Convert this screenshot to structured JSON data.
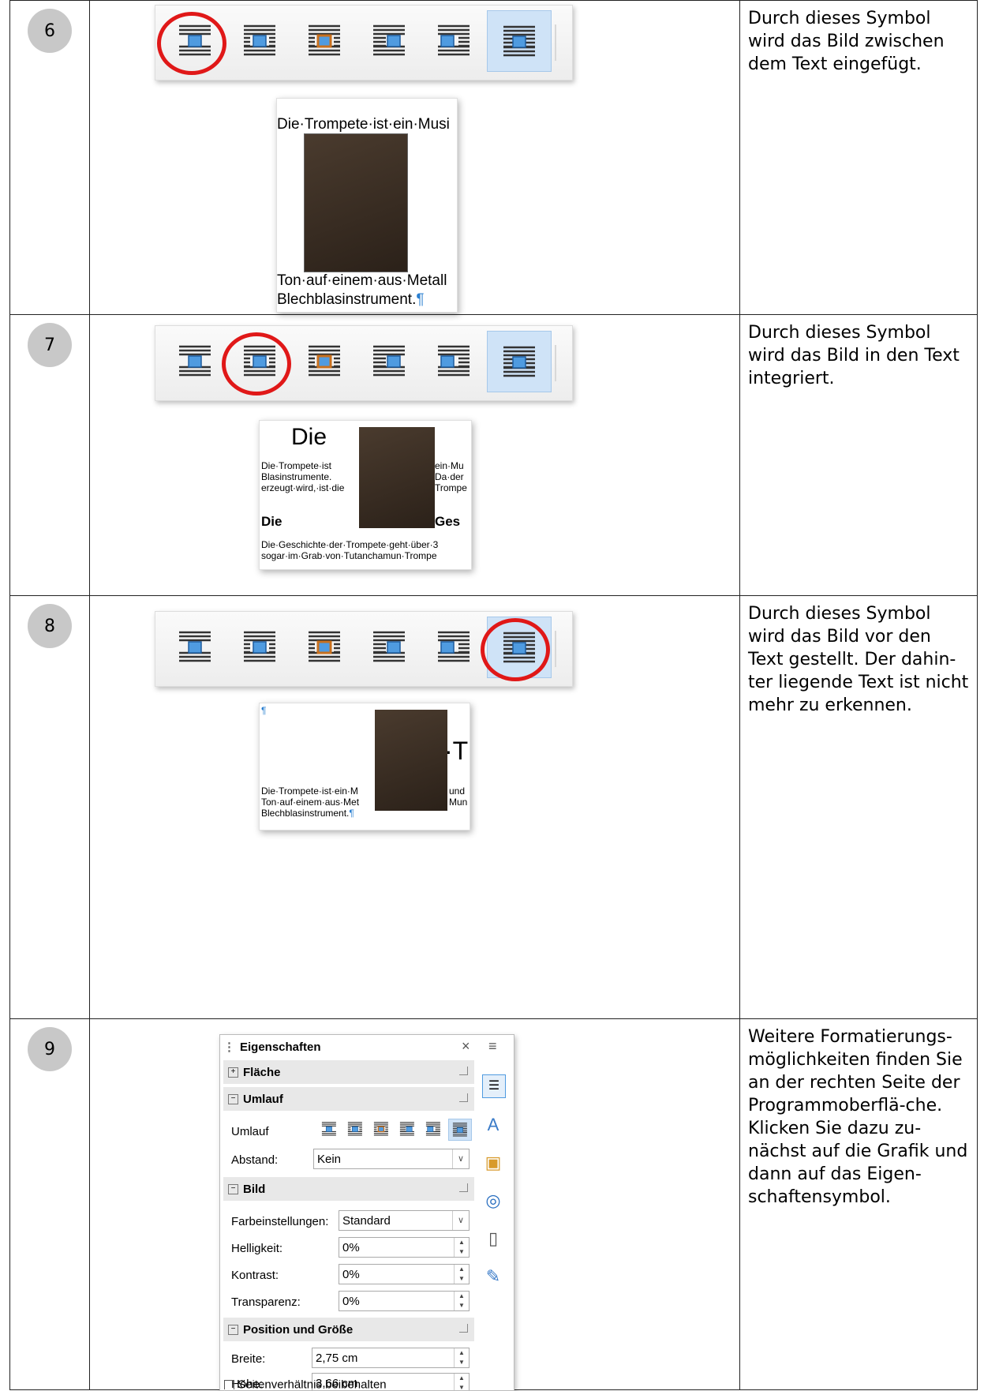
{
  "rows": [
    {
      "num": "6",
      "text": "Durch dieses Symbol wird das Bild zwischen dem Text eingefügt."
    },
    {
      "num": "7",
      "text": "Durch dieses Symbol wird das Bild in den Text integriert."
    },
    {
      "num": "8",
      "text": "Durch dieses Symbol wird das Bild vor den Text gestellt. Der dahin-ter liegende Text ist nicht mehr zu erkennen."
    },
    {
      "num": "9",
      "text": "Weitere Formatierungs-möglichkeiten finden Sie an der rechten Seite der Programmoberflä-che. Klicken Sie dazu zu-nächst auf die Grafik und dann auf das Eigen-schaftensymbol."
    }
  ],
  "snap6": {
    "line1": "Die·Trompete·ist·ein·Musi",
    "line2": "Ton·auf·einem·aus·Metall",
    "line3": "Blechblasinstrument.",
    "pilcrow": "¶"
  },
  "snap7": {
    "heading": "Die",
    "c1": [
      "Die·Trompete·ist",
      "Blasinstrumente.",
      "erzeugt·wird,·ist·die"
    ],
    "c2": [
      "ein·Mu",
      "Da·der",
      "Trompe"
    ],
    "bold_left": "Die",
    "bold_right": "Ges",
    "p1": "Die·Geschichte·der·Trompete·geht·über·3",
    "p2": "sogar·im·Grab·von·Tutanchamun·Trompe"
  },
  "snap8": {
    "pilcrow": "¶",
    "big": "·T",
    "l1": "Die·Trompete·ist·ein·M",
    "l1r": "und",
    "l2": "Ton·auf·einem·aus·Met",
    "l2r": "Mun",
    "l3": "Blechblasinstrument."
  },
  "panel": {
    "title": "Eigenschaften",
    "close": "×",
    "menu": "≡",
    "sec_flaeche": "Fläche",
    "sec_umlauf": "Umlauf",
    "umlauf_label": "Umlauf",
    "abstand_label": "Abstand:",
    "abstand_value": "Kein",
    "sec_bild": "Bild",
    "farb_label": "Farbeinstellungen:",
    "farb_value": "Standard",
    "hell_label": "Helligkeit:",
    "hell_value": "0%",
    "kontrast_label": "Kontrast:",
    "kontrast_value": "0%",
    "transp_label": "Transparenz:",
    "transp_value": "0%",
    "sec_pos": "Position und Größe",
    "breite_label": "Breite:",
    "breite_value": "2,75 cm",
    "hoehe_label": "Höhe:",
    "hoehe_value": "3,66 cm",
    "ratio_label": "Seitenverhältnis beibehalten",
    "plus": "+",
    "minus": "−"
  },
  "colors": {
    "accent": "#4f9be0",
    "ring": "#e01818",
    "badge": "#c8c8c8",
    "orange": "#c8701e"
  }
}
